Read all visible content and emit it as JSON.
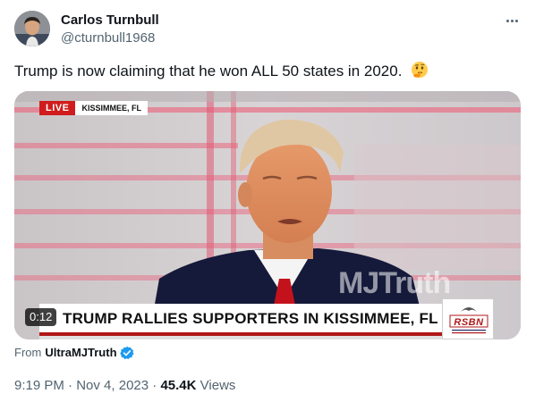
{
  "author": {
    "name": "Carlos Turnbull",
    "handle": "@cturnbull1968"
  },
  "tweet": {
    "text": "Trump is now claiming that he won ALL 50 states in 2020.",
    "emoji": "thinking-face"
  },
  "video": {
    "live_label": "LIVE",
    "location": "KISSIMMEE, FL",
    "headline": "TRUMP RALLIES SUPPORTERS IN KISSIMMEE, FL",
    "watermark": "MJTruth",
    "channel_logo": "RSBN",
    "duration": "0:12"
  },
  "source": {
    "prefix": "From",
    "account": "UltraMJTruth"
  },
  "meta": {
    "time": "9:19 PM",
    "sep": "·",
    "date": "Nov 4, 2023",
    "views_count": "45.4K",
    "views_label": "Views"
  },
  "colors": {
    "verified": "#1d9bf0",
    "live_red": "#d01c1c",
    "secondary_text": "#536471"
  }
}
